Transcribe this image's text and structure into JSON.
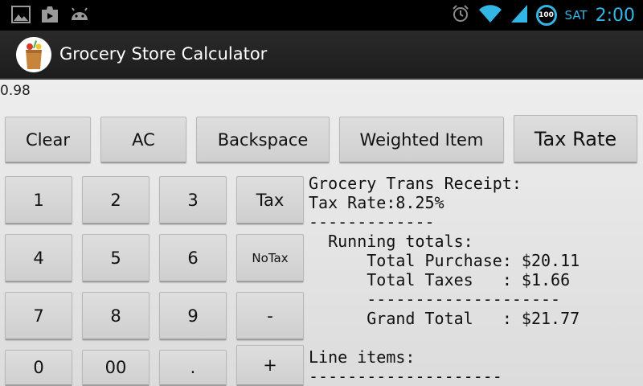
{
  "status_bar": {
    "left_icons": [
      "picture-icon",
      "play-store-icon",
      "android-icon"
    ],
    "right_icons": [
      "alarm-icon",
      "wifi-icon",
      "signal-icon",
      "battery-icon"
    ],
    "battery_level": "100",
    "day": "SAT",
    "time": "2:00",
    "accent_color": "#33b5e5"
  },
  "action_bar": {
    "title": "Grocery Store Calculator",
    "icon": "grocery-bag-icon"
  },
  "display": {
    "value": "0.98"
  },
  "top_row": {
    "clear": "Clear",
    "ac": "AC",
    "backspace": "Backspace",
    "weighted_item": "Weighted Item",
    "tax_rate": "Tax Rate"
  },
  "keypad": {
    "k1": "1",
    "k2": "2",
    "k3": "3",
    "k4": "4",
    "k5": "5",
    "k6": "6",
    "k7": "7",
    "k8": "8",
    "k9": "9",
    "k0": "0",
    "k00": "00",
    "dot": ".",
    "tax": "Tax",
    "notax": "NoTax",
    "minus": "-",
    "plus": "+"
  },
  "receipt": {
    "lines": [
      "Grocery Trans Receipt:",
      "Tax Rate:8.25%",
      "-------------",
      "  Running totals:",
      "      Total Purchase: $20.11",
      "      Total Taxes   : $1.66",
      "      --------------------",
      "      Grand Total   : $21.77",
      "",
      "Line items:",
      "--------------------"
    ]
  }
}
